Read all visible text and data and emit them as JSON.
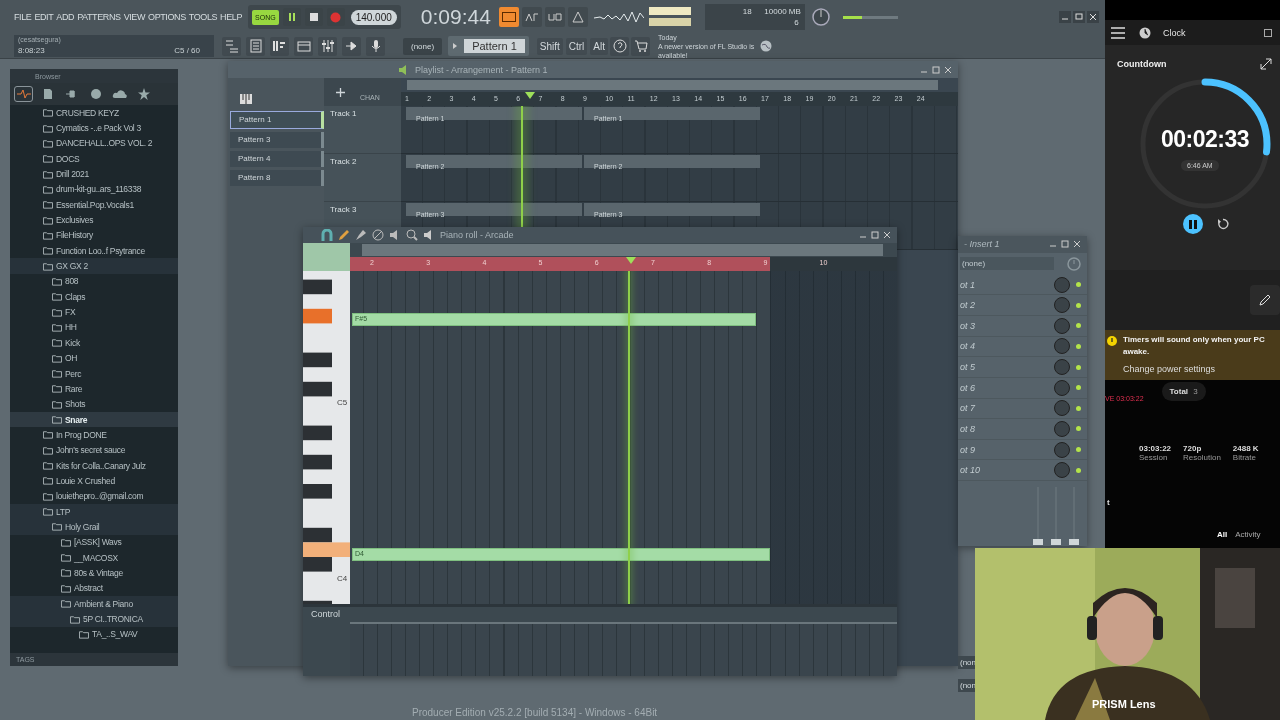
{
  "menu": [
    "FILE",
    "EDIT",
    "ADD",
    "PATTERNS",
    "VIEW",
    "OPTIONS",
    "TOOLS",
    "HELP"
  ],
  "transport": {
    "song_mode": {
      "label": "SONG",
      "selected": true
    },
    "playing": true,
    "tempo": "140.000",
    "time": "0:09:44"
  },
  "hint_bar": {
    "title": "(cesatsegura)",
    "time": "8:08:23",
    "note": "C5 / 60"
  },
  "monitor": {
    "cpu": "18",
    "memory": "10000 MB",
    "polyphony": "6"
  },
  "master_volume": {
    "level": 0.35
  },
  "toolbar": {
    "pattern_source": "(none)",
    "pattern": "Pattern 1",
    "keys": [
      "Shift",
      "Ctrl",
      "Alt"
    ],
    "news_date": "Today",
    "news": "A newer version of FL Studio is available!"
  },
  "browser": {
    "title": "Browser",
    "tags": "TAGS",
    "items": [
      {
        "label": "CRUSHED KEYZ",
        "selected": false
      },
      {
        "label": "Cymatics -..e Pack Vol 3",
        "selected": false
      },
      {
        "label": "DANCEHALL..OPS VOL. 2",
        "selected": false
      },
      {
        "label": "DOCS",
        "selected": false
      },
      {
        "label": "Drill 2021",
        "selected": false
      },
      {
        "label": "drum-kit-gu..ars_116338",
        "selected": false
      },
      {
        "label": "Essential.Pop.Vocals1",
        "selected": false
      },
      {
        "label": "Exclusives",
        "selected": false
      },
      {
        "label": "FileHistory",
        "selected": false
      },
      {
        "label": "Function Loo..f Psytrance",
        "selected": false
      },
      {
        "label": "GX GX 2",
        "selected": false,
        "expanded": true,
        "children": [
          {
            "label": "808",
            "selected": false
          },
          {
            "label": "Claps",
            "selected": false
          },
          {
            "label": "FX",
            "selected": false
          },
          {
            "label": "HH",
            "selected": false
          },
          {
            "label": "Kick",
            "selected": false
          },
          {
            "label": "OH",
            "selected": false
          },
          {
            "label": "Perc",
            "selected": false
          },
          {
            "label": "Rare",
            "selected": false
          },
          {
            "label": "Shots",
            "selected": false
          },
          {
            "label": "Snare",
            "selected": true
          }
        ]
      },
      {
        "label": "In Prog DONE",
        "selected": false
      },
      {
        "label": "John's secret sauce",
        "selected": false
      },
      {
        "label": "Kits for Colla..Canary Julz",
        "selected": false
      },
      {
        "label": "Louie X Crushed",
        "selected": false
      },
      {
        "label": "louiethepro..@gmail.com",
        "selected": false
      },
      {
        "label": "LTP",
        "selected": false,
        "expanded": true,
        "children": [
          {
            "label": "Holy Grail",
            "selected": false,
            "expanded": true,
            "children": [
              {
                "label": "[ASSK] Wavs",
                "selected": false
              },
              {
                "label": "__MACOSX",
                "selected": false
              },
              {
                "label": "80s & Vintage",
                "selected": false
              },
              {
                "label": "Abstract",
                "selected": false
              },
              {
                "label": "Ambient & Piano",
                "selected": false,
                "expanded": true,
                "children": [
                  {
                    "label": "5P CI..TRONICA",
                    "selected": false,
                    "expanded": true,
                    "children": [
                      {
                        "label": "TA_..S_WAV",
                        "selected": false
                      }
                    ]
                  }
                ]
              }
            ]
          }
        ]
      }
    ]
  },
  "playlist": {
    "title": "Playlist - Arrangement - Pattern 1",
    "channel_tab": "CHAN",
    "patterns": [
      {
        "label": "Pattern 1",
        "selected": true
      },
      {
        "label": "Pattern 3",
        "selected": false
      },
      {
        "label": "Pattern 4",
        "selected": false
      },
      {
        "label": "Pattern 8",
        "selected": false
      }
    ],
    "ruler": [
      "1",
      "2",
      "3",
      "4",
      "5",
      "6",
      "7",
      "8",
      "9",
      "10",
      "11",
      "12",
      "13",
      "14",
      "15",
      "16",
      "17",
      "18",
      "19",
      "20",
      "21",
      "22",
      "23",
      "24"
    ],
    "tracks": [
      {
        "name": "Track 1",
        "clips": [
          "Pattern 1",
          "Pattern 1"
        ]
      },
      {
        "name": "Track 2",
        "clips": [
          "Pattern 2",
          "Pattern 2"
        ]
      },
      {
        "name": "Track 3",
        "clips": [
          "Pattern 3",
          "Pattern 3"
        ]
      }
    ]
  },
  "piano_roll": {
    "title": "Piano roll - Arcade",
    "ruler": [
      "2",
      "3",
      "4",
      "5",
      "6",
      "7",
      "8",
      "9",
      "10"
    ],
    "key_labels": [
      "C5",
      "C4"
    ],
    "notes": [
      "F#5",
      "D4"
    ],
    "control": "Control"
  },
  "mixer_insert": {
    "title": "- Insert 1",
    "preset": "(none)",
    "slots": [
      {
        "label": "ot 1",
        "on": true
      },
      {
        "label": "ot 2",
        "on": true
      },
      {
        "label": "ot 3",
        "on": true
      },
      {
        "label": "ot 4",
        "on": true
      },
      {
        "label": "ot 5",
        "on": true
      },
      {
        "label": "ot 6",
        "on": true
      },
      {
        "label": "ot 7",
        "on": true
      },
      {
        "label": "ot 8",
        "on": true
      },
      {
        "label": "ot 9",
        "on": true
      },
      {
        "label": "ot 10",
        "on": true
      }
    ],
    "routes": [
      "(non",
      "(non"
    ]
  },
  "status_bar": "Producer Edition v25.2.2 [build 5134] - Windows - 64Bit",
  "clock": {
    "app_title": "Clock",
    "section": "Countdown",
    "remaining": "00:02:33",
    "alarm_time": "6:46 AM",
    "level": 0.27,
    "running": true,
    "warning": "Timers will sound only when your PC awake.",
    "warning_link": "Change power settings"
  },
  "stream": {
    "total_label": "Total",
    "total": "3",
    "live": "VE",
    "live_time": "03:03:22",
    "stats": [
      {
        "value": "03:03:22",
        "label": "Session"
      },
      {
        "value": "720p",
        "label": "Resolution"
      },
      {
        "value": "2488 K",
        "label": "Bitrate"
      }
    ],
    "section_fragment": "t",
    "tabs": [
      {
        "label": "All",
        "selected": true
      },
      {
        "label": "Activity",
        "selected": false
      }
    ]
  },
  "webcam": {
    "kind": "picture",
    "caption": "PRISM Lens"
  }
}
